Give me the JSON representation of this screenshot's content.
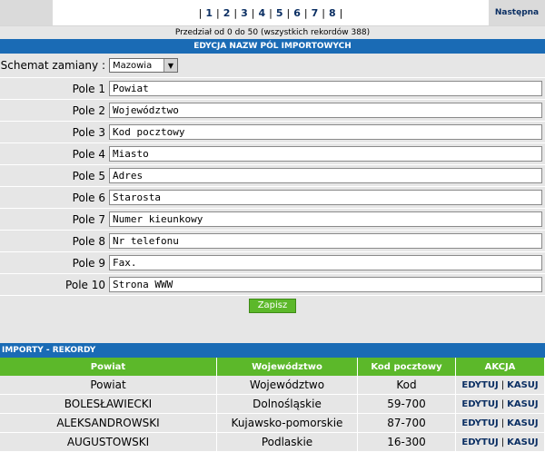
{
  "pagination": {
    "pages": [
      "1",
      "2",
      "3",
      "4",
      "5",
      "6",
      "7",
      "8"
    ],
    "next_label": "Następna",
    "range_text": "Przedział od 0 do 50 (wszystkich rekordów 388)"
  },
  "edit_section": {
    "title": "EDYCJA NAZW PÓL IMPORTOWYCH",
    "schema_label": "Schemat zamiany :",
    "schema_value": "Mazowia",
    "fields": [
      {
        "label": "Pole 1",
        "value": "Powiat"
      },
      {
        "label": "Pole 2",
        "value": "Województwo"
      },
      {
        "label": "Pole 3",
        "value": "Kod pocztowy"
      },
      {
        "label": "Pole 4",
        "value": "Miasto"
      },
      {
        "label": "Pole 5",
        "value": "Adres"
      },
      {
        "label": "Pole 6",
        "value": "Starosta"
      },
      {
        "label": "Pole 7",
        "value": "Numer kieunkowy"
      },
      {
        "label": "Pole 8",
        "value": "Nr telefonu"
      },
      {
        "label": "Pole 9",
        "value": "Fax."
      },
      {
        "label": "Pole 10",
        "value": "Strona WWW"
      }
    ],
    "save_label": "Zapisz"
  },
  "records_section": {
    "title": "IMPORTY - REKORDY",
    "columns": [
      "Powiat",
      "Województwo",
      "Kod pocztowy",
      "AKCJA"
    ],
    "edit_label": "EDYTUJ",
    "delete_label": "KASUJ",
    "rows": [
      [
        "Powiat",
        "Województwo",
        "Kod"
      ],
      [
        "BOLESŁAWIECKI",
        "Dolnośląskie",
        "59-700"
      ],
      [
        "ALEKSANDROWSKI",
        "Kujawsko-pomorskie",
        "87-700"
      ],
      [
        "AUGUSTOWSKI",
        "Podlaskie",
        "16-300"
      ]
    ]
  }
}
